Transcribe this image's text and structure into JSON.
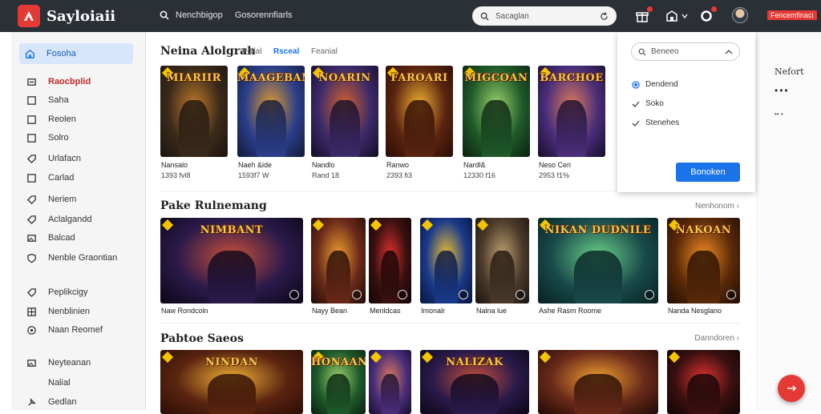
{
  "app": {
    "title": "Sayloiaii"
  },
  "topbar": {
    "link1": "Nenchbigop",
    "link2": "Gosorennfiarls",
    "search_placeholder": "Sacaglan",
    "user_badge": "Fencemfinaci"
  },
  "sidebar": {
    "items": [
      {
        "label": "Fosoha",
        "icon": "home-icon",
        "state": "active"
      },
      {
        "label": "Raocbplid",
        "icon": "box-icon",
        "state": "highlighted"
      },
      {
        "label": "Saha",
        "icon": "square-icon"
      },
      {
        "label": "Reolen",
        "icon": "square-icon"
      },
      {
        "label": "Solro",
        "icon": "square-icon"
      },
      {
        "label": "Urlafacn",
        "icon": "tag-icon"
      },
      {
        "label": "Carlad",
        "icon": "square-icon"
      },
      {
        "label": "Neriem",
        "icon": "tag-icon"
      },
      {
        "label": "Aclalgandd",
        "icon": "tag-icon"
      },
      {
        "label": "Balcad",
        "icon": "image-icon"
      },
      {
        "label": "Nenble Graontian",
        "icon": "shield-icon"
      },
      {
        "label": "Peplikcigy",
        "icon": "tag-icon"
      },
      {
        "label": "Nenblinien",
        "icon": "grid-icon"
      },
      {
        "label": "Naan Reomef",
        "icon": "circle-icon"
      },
      {
        "label": "Neyteanan",
        "icon": "image-icon"
      },
      {
        "label": "Nalial",
        "icon": "none"
      },
      {
        "label": "Gedlan",
        "icon": "pin-icon"
      }
    ]
  },
  "section1": {
    "title": "Neina Alolgrah",
    "tabs": [
      "Pollal",
      "Rsceal",
      "Feanial"
    ],
    "cards": [
      {
        "title": "MIARIIR",
        "name": "Nansalo",
        "sub": "1393 fvl8"
      },
      {
        "title": "MAAGEBAN",
        "name": "Naeh &ide",
        "sub": "1593f7 W"
      },
      {
        "title": "NOARIN",
        "name": "Nandlo",
        "sub": "Rand 18"
      },
      {
        "title": "FAROARI",
        "name": "Ranwo",
        "sub": "2393 fi3"
      },
      {
        "title": "MIGCOAN",
        "name": "Nardl&",
        "sub": "12330 f16"
      },
      {
        "title": "BARCHOE",
        "name": "Neso Ceri",
        "sub": "2953 f1%"
      }
    ]
  },
  "section2": {
    "title": "Pake Rulnemang",
    "see_more": "Nenhonom",
    "cards": [
      {
        "title": "NIMBANT",
        "name": "Naw Rondcoln"
      },
      {
        "title": "",
        "name": "Nayy Bean"
      },
      {
        "title": "",
        "name": "Menldcas"
      },
      {
        "title": "",
        "name": "Imonalr"
      },
      {
        "title": "",
        "name": "Nalna lue"
      },
      {
        "title": "NIKAN DUDNILE",
        "name": "Ashe Rasm Roome"
      },
      {
        "title": "NAKOAN",
        "name": "Nanda Nesglano"
      }
    ]
  },
  "section3": {
    "title": "Pabtoe Saeos",
    "see_more": "Danndoren",
    "cards": [
      {
        "title": "NINDAN"
      },
      {
        "title": "HONAAN"
      },
      {
        "title": ""
      },
      {
        "title": "NALIZAK"
      },
      {
        "title": ""
      },
      {
        "title": ""
      }
    ]
  },
  "dropdown": {
    "select_label": "Beneeo",
    "options": [
      {
        "label": "Dendend",
        "mark": "radio"
      },
      {
        "label": "Soko",
        "mark": "check"
      },
      {
        "label": "Stenehes",
        "mark": "check"
      }
    ],
    "button": "Bonoken"
  },
  "rightcol": {
    "label": "Nefort",
    "dots": "•••",
    "dots2": "•• •"
  },
  "colors": {
    "accent": "#1a73e8",
    "brand": "#e53935",
    "topbar": "#2b2f36"
  }
}
